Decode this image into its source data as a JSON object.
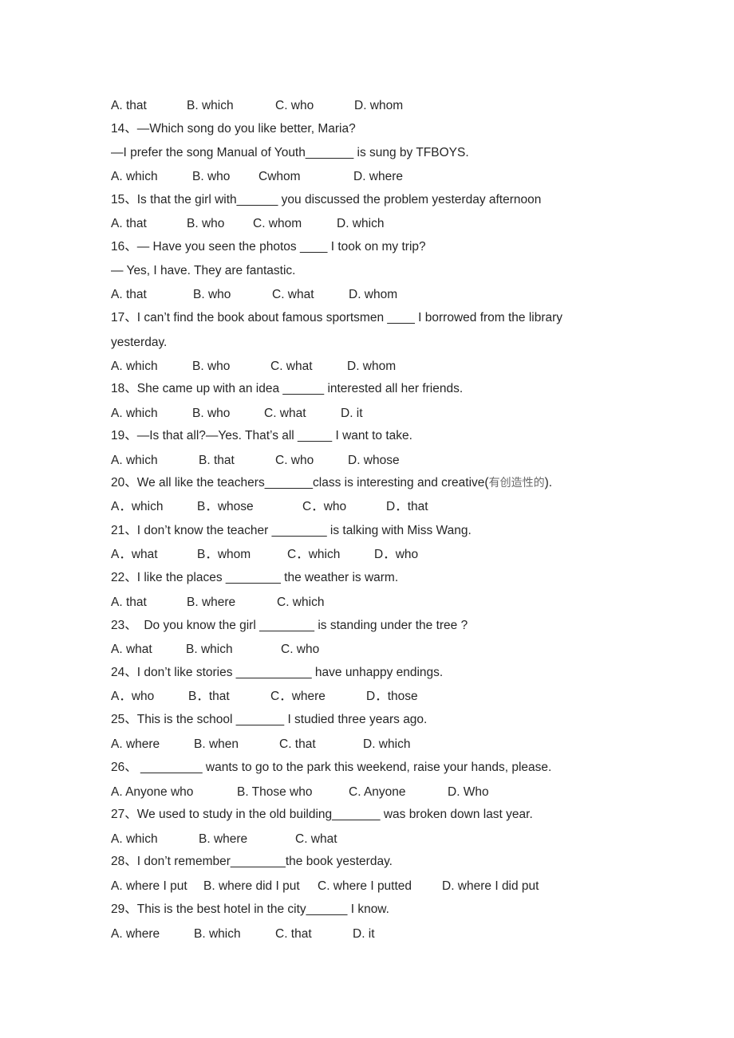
{
  "document": {
    "lines": [
      {
        "type": "options",
        "options": [
          "A. that",
          "B. which",
          "C. who",
          "D. whom"
        ]
      },
      {
        "type": "question",
        "text": "14、—Which song do you like better, Maria?"
      },
      {
        "type": "text",
        "text": "—I prefer the song Manual of Youth_______ is sung by TFBOYS."
      },
      {
        "type": "options",
        "options": [
          "A. which",
          "B. who",
          "Cwhom",
          "D. where"
        ]
      },
      {
        "type": "question",
        "text": "15、Is that the girl with______ you discussed the problem yesterday afternoon"
      },
      {
        "type": "options",
        "options": [
          "A. that",
          "B. who",
          "C. whom",
          "D. which"
        ]
      },
      {
        "type": "question",
        "text": "16、— Have you seen the photos ____ I took on my trip?"
      },
      {
        "type": "text",
        "text": "— Yes, I have. They are fantastic."
      },
      {
        "type": "options",
        "options": [
          "A. that",
          "B. who",
          "C. what",
          "D. whom"
        ]
      },
      {
        "type": "question",
        "text": "17、I can’t find the book about famous sportsmen ____ I borrowed from the library"
      },
      {
        "type": "text",
        "text": "yesterday."
      },
      {
        "type": "options",
        "options": [
          "A. which",
          "B. who",
          "C. what",
          "D. whom"
        ]
      },
      {
        "type": "question",
        "text": "18、She came up with an idea ______ interested all her friends."
      },
      {
        "type": "options",
        "options": [
          "A. which",
          "B. who",
          "C. what",
          "D. it"
        ]
      },
      {
        "type": "question",
        "text": "19、—Is that all?—Yes. That’s all _____ I want to take."
      },
      {
        "type": "options",
        "options": [
          "A. which",
          "B. that",
          "C. who",
          "D. whose"
        ]
      },
      {
        "type": "question",
        "text": "20、We all like the teachers_______class is interesting and creative(",
        "cn": "有创造性的",
        "tail": ")."
      },
      {
        "type": "options",
        "options": [
          "A．which",
          "B．whose",
          "C．who",
          "D．that"
        ]
      },
      {
        "type": "question",
        "text": "21、I don’t know the teacher ________ is talking with Miss Wang."
      },
      {
        "type": "options",
        "options": [
          "A．what",
          "B．whom",
          "C．which",
          "D．who"
        ]
      },
      {
        "type": "question",
        "text": "22、I like the places ________ the weather is warm."
      },
      {
        "type": "options",
        "options": [
          "A. that",
          "B. where",
          "C. which"
        ]
      },
      {
        "type": "question",
        "text": "23、  Do you know the girl ________ is standing under the tree ?"
      },
      {
        "type": "options",
        "options": [
          "A. what",
          "B. which",
          "C. who"
        ]
      },
      {
        "type": "question",
        "text": "24、I don’t like stories ___________ have unhappy endings."
      },
      {
        "type": "options",
        "options": [
          "A．who",
          "B．that",
          "C．where",
          "D．those"
        ]
      },
      {
        "type": "question",
        "text": "25、This is the school _______ I studied three years ago."
      },
      {
        "type": "options",
        "options": [
          "A. where",
          "B. when",
          "C. that",
          "D. which"
        ]
      },
      {
        "type": "question",
        "text": "26、 _________ wants to go to the park this weekend, raise your hands, please."
      },
      {
        "type": "options",
        "options": [
          "A. Anyone who",
          "B. Those who",
          "C. Anyone",
          "D. Who"
        ]
      },
      {
        "type": "question",
        "text": "27、We used to study in the old building_______ was broken down last year."
      },
      {
        "type": "options",
        "options": [
          "A. which",
          "B. where",
          "C. what"
        ]
      },
      {
        "type": "question",
        "text": "28、I don’t remember________the book yesterday."
      },
      {
        "type": "options",
        "options": [
          "A. where I put",
          "B. where did I put",
          "C. where I putted",
          "D. where I did put"
        ]
      },
      {
        "type": "question",
        "text": "29、This is the best hotel in the city______ I know."
      },
      {
        "type": "options",
        "options": [
          "A. where",
          "B. which",
          "C. that",
          "D. it"
        ]
      }
    ]
  }
}
